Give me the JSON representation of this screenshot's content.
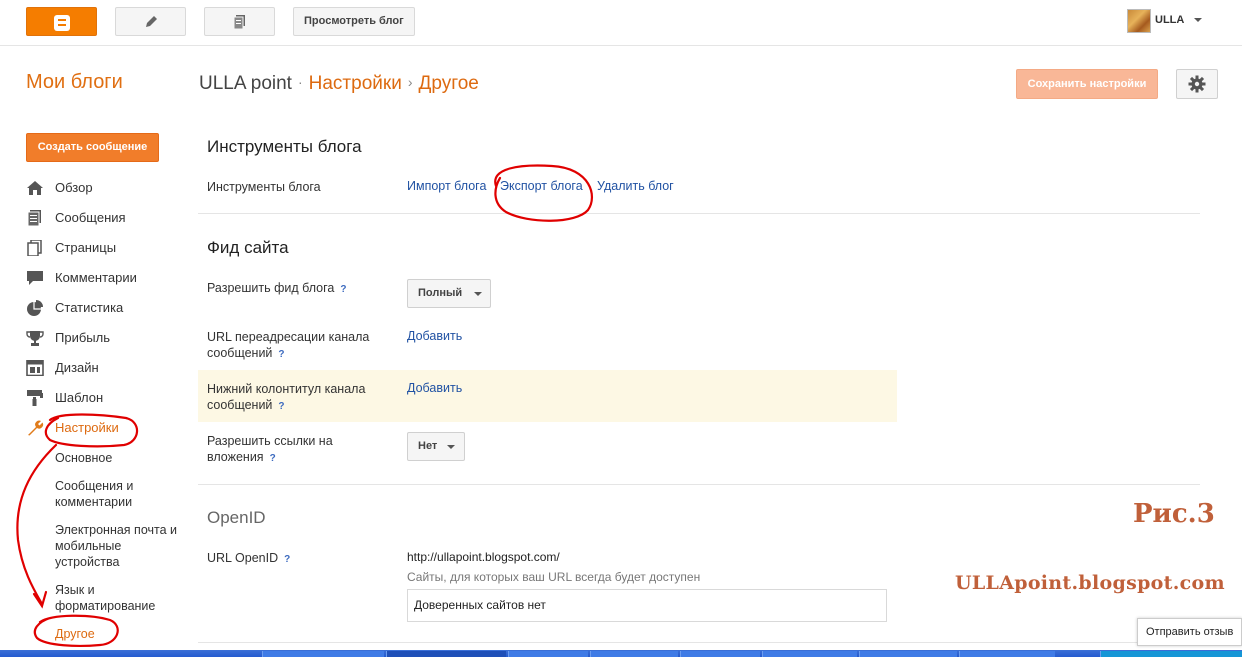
{
  "topbar": {
    "view_blog_label": "Просмотреть блог",
    "username": "ULLA"
  },
  "header": {
    "my_blogs": "Мои блоги",
    "blog_name": "ULLA point",
    "sep1": "·",
    "section": "Настройки",
    "sep2": "›",
    "subsection": "Другое",
    "save_label": "Сохранить настройки"
  },
  "sidebar": {
    "create_label": "Создать сообщение",
    "items": [
      {
        "label": "Обзор",
        "icon": "home-icon"
      },
      {
        "label": "Сообщения",
        "icon": "posts-icon"
      },
      {
        "label": "Страницы",
        "icon": "pages-icon"
      },
      {
        "label": "Комментарии",
        "icon": "comment-icon"
      },
      {
        "label": "Статистика",
        "icon": "stats-icon"
      },
      {
        "label": "Прибыль",
        "icon": "trophy-icon"
      },
      {
        "label": "Дизайн",
        "icon": "layout-icon"
      },
      {
        "label": "Шаблон",
        "icon": "template-icon"
      },
      {
        "label": "Настройки",
        "icon": "wrench-icon"
      }
    ],
    "subitems": [
      "Основное",
      "Сообщения и комментарии",
      "Электронная почта и мобильные устройства",
      "Язык и форматирование",
      "Другое"
    ]
  },
  "blog_tools": {
    "title": "Инструменты блога",
    "label": "Инструменты блога",
    "import_link": "Импорт блога",
    "export_link": "Экспорт блога",
    "delete_link": "Удалить блог"
  },
  "feed": {
    "title": "Фид сайта",
    "allow_feed_label": "Разрешить фид блога",
    "allow_feed_value": "Полный",
    "redirect_label": "URL переадресации канала сообщений",
    "redirect_link": "Добавить",
    "footer_label": "Нижний колонтитул канала сообщений",
    "footer_link": "Добавить",
    "enclosure_label": "Разрешить ссылки на вложения",
    "enclosure_value": "Нет",
    "help": "?"
  },
  "openid": {
    "title": "OpenID",
    "url_label": "URL OpenID",
    "url_value": "http://ullapoint.blogspot.com/",
    "sites_text": "Сайты, для которых ваш URL всегда будет доступен",
    "trusted_text": "Доверенных сайтов нет"
  },
  "overlay": {
    "figure_label": "Рис.3",
    "watermark": "ULLApoint.blogspot.com"
  },
  "feedback_label": "Отправить отзыв",
  "colors": {
    "brand_orange": "#f57d00",
    "accent_text": "#dd6a10",
    "link_blue": "#2152a3",
    "annotation_red": "#e00000"
  }
}
